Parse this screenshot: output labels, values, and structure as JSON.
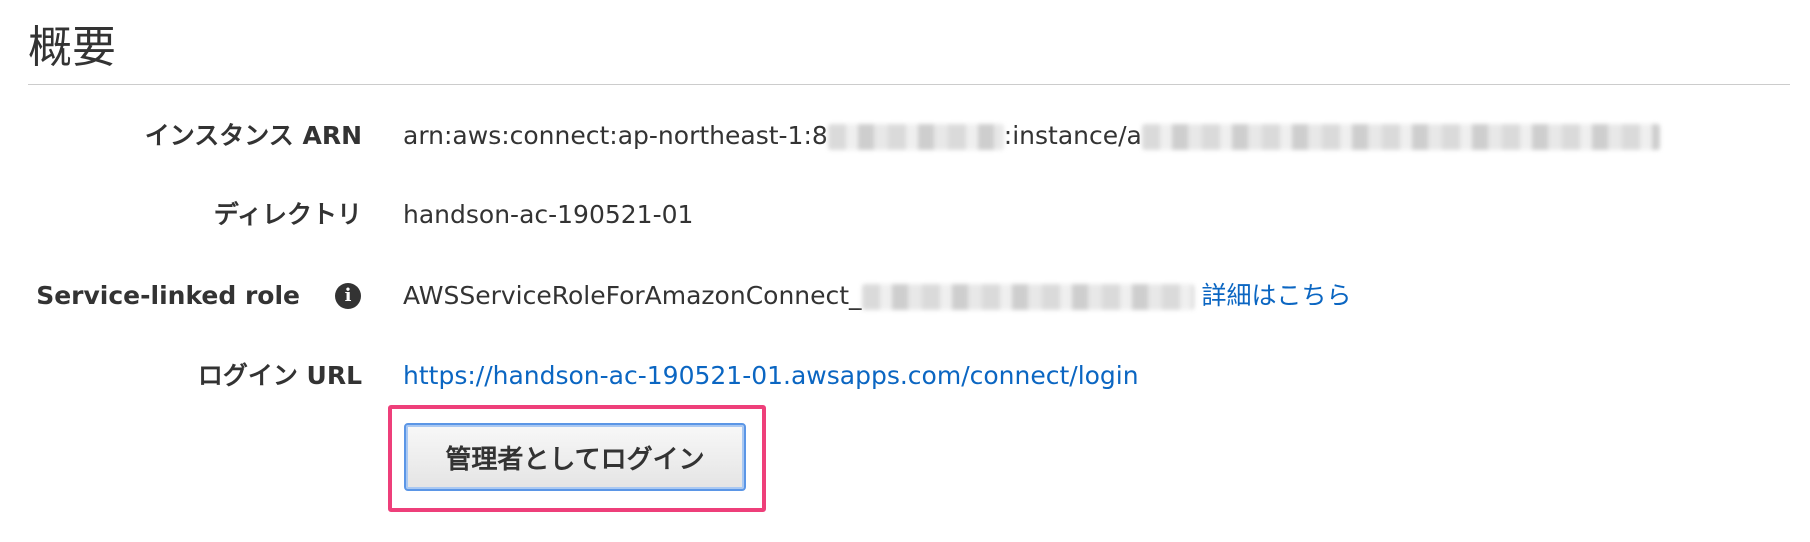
{
  "header": {
    "title": "概要"
  },
  "fields": {
    "instance_arn": {
      "label": "インスタンス ARN",
      "value_prefix": "arn:aws:connect:ap-northeast-1:8",
      "value_middle": ":instance/a"
    },
    "directory": {
      "label": "ディレクトリ",
      "value": "handson-ac-190521-01"
    },
    "service_linked_role": {
      "label": "Service-linked role",
      "info_icon": "info-icon",
      "value_prefix": "AWSServiceRoleForAmazonConnect_",
      "link_label": "詳細はこちら"
    },
    "login_url": {
      "label": "ログイン URL",
      "url": "https://handson-ac-190521-01.awsapps.com/connect/login"
    }
  },
  "actions": {
    "admin_login_label": "管理者としてログイン"
  },
  "colors": {
    "link": "#0b66c2",
    "highlight": "#ee3f7a",
    "button_border": "#5b96e6"
  }
}
